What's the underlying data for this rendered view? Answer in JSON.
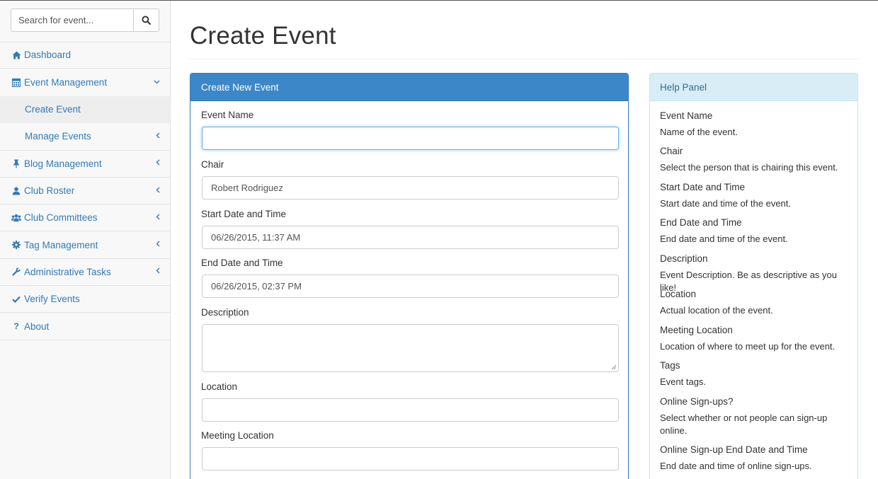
{
  "sidebar": {
    "search": {
      "placeholder": "Search for event..."
    },
    "items": [
      {
        "label": "Dashboard",
        "icon": "home-icon",
        "has_chevron": false
      },
      {
        "label": "Event Management",
        "icon": "calendar-icon",
        "expanded": true
      },
      {
        "label": "Blog Management",
        "icon": "pin-icon"
      },
      {
        "label": "Club Roster",
        "icon": "user-icon"
      },
      {
        "label": "Club Committees",
        "icon": "users-icon"
      },
      {
        "label": "Tag Management",
        "icon": "cog-icon"
      },
      {
        "label": "Administrative Tasks",
        "icon": "wrench-icon"
      },
      {
        "label": "Verify Events",
        "icon": "check-icon"
      },
      {
        "label": "About",
        "icon": "question-icon"
      }
    ],
    "submenu": [
      {
        "label": "Create Event",
        "active": true
      },
      {
        "label": "Manage Events",
        "active": false
      }
    ]
  },
  "main": {
    "title": "Create Event",
    "form_panel": {
      "heading": "Create New Event",
      "fields": [
        {
          "label": "Event Name",
          "value": ""
        },
        {
          "label": "Chair",
          "value": "Robert Rodriguez"
        },
        {
          "label": "Start Date and Time",
          "value": "06/26/2015, 11:37  AM"
        },
        {
          "label": "End Date and Time",
          "value": "06/26/2015, 02:37  PM"
        },
        {
          "label": "Description",
          "value": ""
        },
        {
          "label": "Location",
          "value": ""
        },
        {
          "label": "Meeting Location",
          "value": ""
        }
      ]
    },
    "help_panel": {
      "heading": "Help Panel",
      "entries": [
        {
          "term": "Event Name",
          "desc": "Name of the event."
        },
        {
          "term": "Chair",
          "desc": "Select the person that is chairing this event."
        },
        {
          "term": "Start Date and Time",
          "desc": "Start date and time of the event."
        },
        {
          "term": "End Date and Time",
          "desc": "End date and time of the event."
        },
        {
          "term": "Description",
          "desc": "Event Description. Be as descriptive as you like!"
        },
        {
          "term": "Location",
          "desc": "Actual location of the event."
        },
        {
          "term": "Meeting Location",
          "desc": "Location of where to meet up for the event."
        },
        {
          "term": "Tags",
          "desc": "Event tags."
        },
        {
          "term": "Online Sign-ups?",
          "desc": "Select whether or not people can sign-up online."
        },
        {
          "term": "Online Sign-up End Date and Time",
          "desc": "End date and time of online sign-ups."
        }
      ]
    }
  },
  "colors": {
    "link": "#337ab7",
    "primary_panel_header": "#3c87c8",
    "info_panel_header": "#d9edf7",
    "info_panel_text": "#31708f"
  }
}
